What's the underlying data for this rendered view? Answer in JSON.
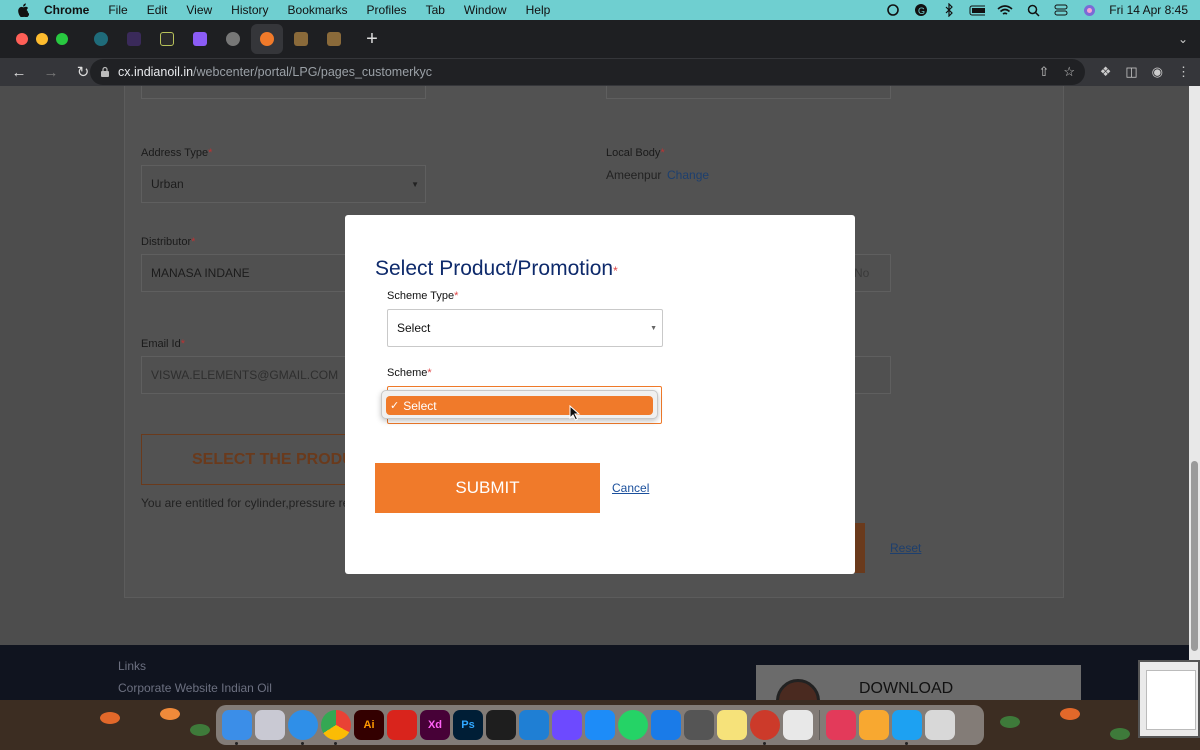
{
  "menubar": {
    "app_name": "Chrome",
    "items": [
      "File",
      "Edit",
      "View",
      "History",
      "Bookmarks",
      "Profiles",
      "Tab",
      "Window",
      "Help"
    ],
    "clock": "Fri 14 Apr  8:45"
  },
  "browser": {
    "url_host": "cx.indianoil.in",
    "url_path": "/webcenter/portal/LPG/pages_customerkyc"
  },
  "form": {
    "address_type_label": "Address Type",
    "address_type_value": "Urban",
    "local_body_label": "Local Body",
    "local_body_value": "Ameenpur",
    "local_body_change": "Change",
    "distributor_label": "Distributor",
    "distributor_value": "MANASA INDANE",
    "email_label": "Email Id",
    "email_value": "VISWA.ELEMENTS@GMAIL.COM",
    "behind_placeholder": "No",
    "select_product_button": "SELECT THE PRODU",
    "entitled_text": "You are entitled for cylinder,pressure reg",
    "reset_link": "Reset",
    "required_mark": "*"
  },
  "footer": {
    "links_heading": "Links",
    "corporate_link": "Corporate Website Indian Oil",
    "download_label": "DOWNLOAD"
  },
  "modal": {
    "title": "Select Product/Promotion",
    "required_mark": "*",
    "scheme_type_label": "Scheme Type",
    "scheme_type_value": "Select",
    "scheme_label": "Scheme",
    "scheme_option": "Select",
    "option_check": "✓",
    "submit_label": "SUBMIT",
    "cancel_label": "Cancel"
  },
  "dock": {
    "apps": [
      "finder",
      "launchpad",
      "safari",
      "chrome",
      "illustrator",
      "acrobat",
      "xd",
      "photoshop",
      "figma",
      "vscode",
      "proton-vpn",
      "app-store",
      "whatsapp",
      "transporter",
      "calculator",
      "notes",
      "compass",
      "screenshot",
      "creative-cloud",
      "sketch",
      "twitter",
      "trash"
    ],
    "labels": {
      "illustrator": "Ai",
      "xd": "Xd",
      "photoshop": "Ps"
    }
  },
  "colors": {
    "accent_orange": "#f07a2a",
    "title_blue": "#0e2a6b",
    "required_red": "#e04545",
    "menubar_bg": "#6fcfd0"
  }
}
